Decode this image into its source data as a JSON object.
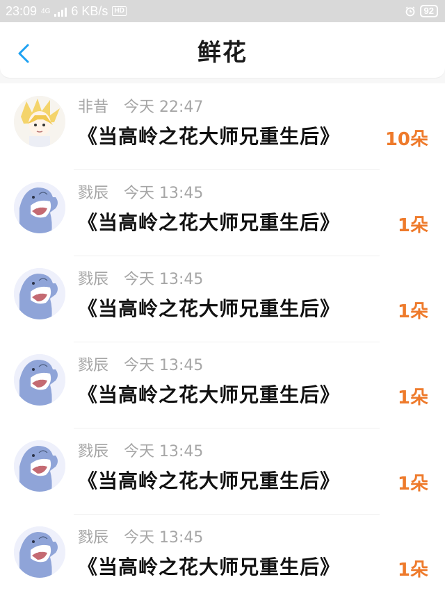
{
  "status_bar": {
    "time": "23:09",
    "network": "4G",
    "speed": "6 KB/s",
    "hd": "HD",
    "battery": "92"
  },
  "header": {
    "title": "鲜花"
  },
  "rows": [
    {
      "user": "非昔",
      "time": "今天 22:47",
      "book": "《当高岭之花大师兄重生后》",
      "count": "10朵",
      "avatar": "blonde-character-avatar"
    },
    {
      "user": "戮辰",
      "time": "今天 13:45",
      "book": "《当高岭之花大师兄重生后》",
      "count": "1朵",
      "avatar": "shark-avatar"
    },
    {
      "user": "戮辰",
      "time": "今天 13:45",
      "book": "《当高岭之花大师兄重生后》",
      "count": "1朵",
      "avatar": "shark-avatar"
    },
    {
      "user": "戮辰",
      "time": "今天 13:45",
      "book": "《当高岭之花大师兄重生后》",
      "count": "1朵",
      "avatar": "shark-avatar"
    },
    {
      "user": "戮辰",
      "time": "今天 13:45",
      "book": "《当高岭之花大师兄重生后》",
      "count": "1朵",
      "avatar": "shark-avatar"
    },
    {
      "user": "戮辰",
      "time": "今天 13:45",
      "book": "《当高岭之花大师兄重生后》",
      "count": "1朵",
      "avatar": "shark-avatar"
    }
  ],
  "colors": {
    "accent": "#1da1f2",
    "count": "#ee7a2b",
    "meta": "#a6a6a6"
  }
}
